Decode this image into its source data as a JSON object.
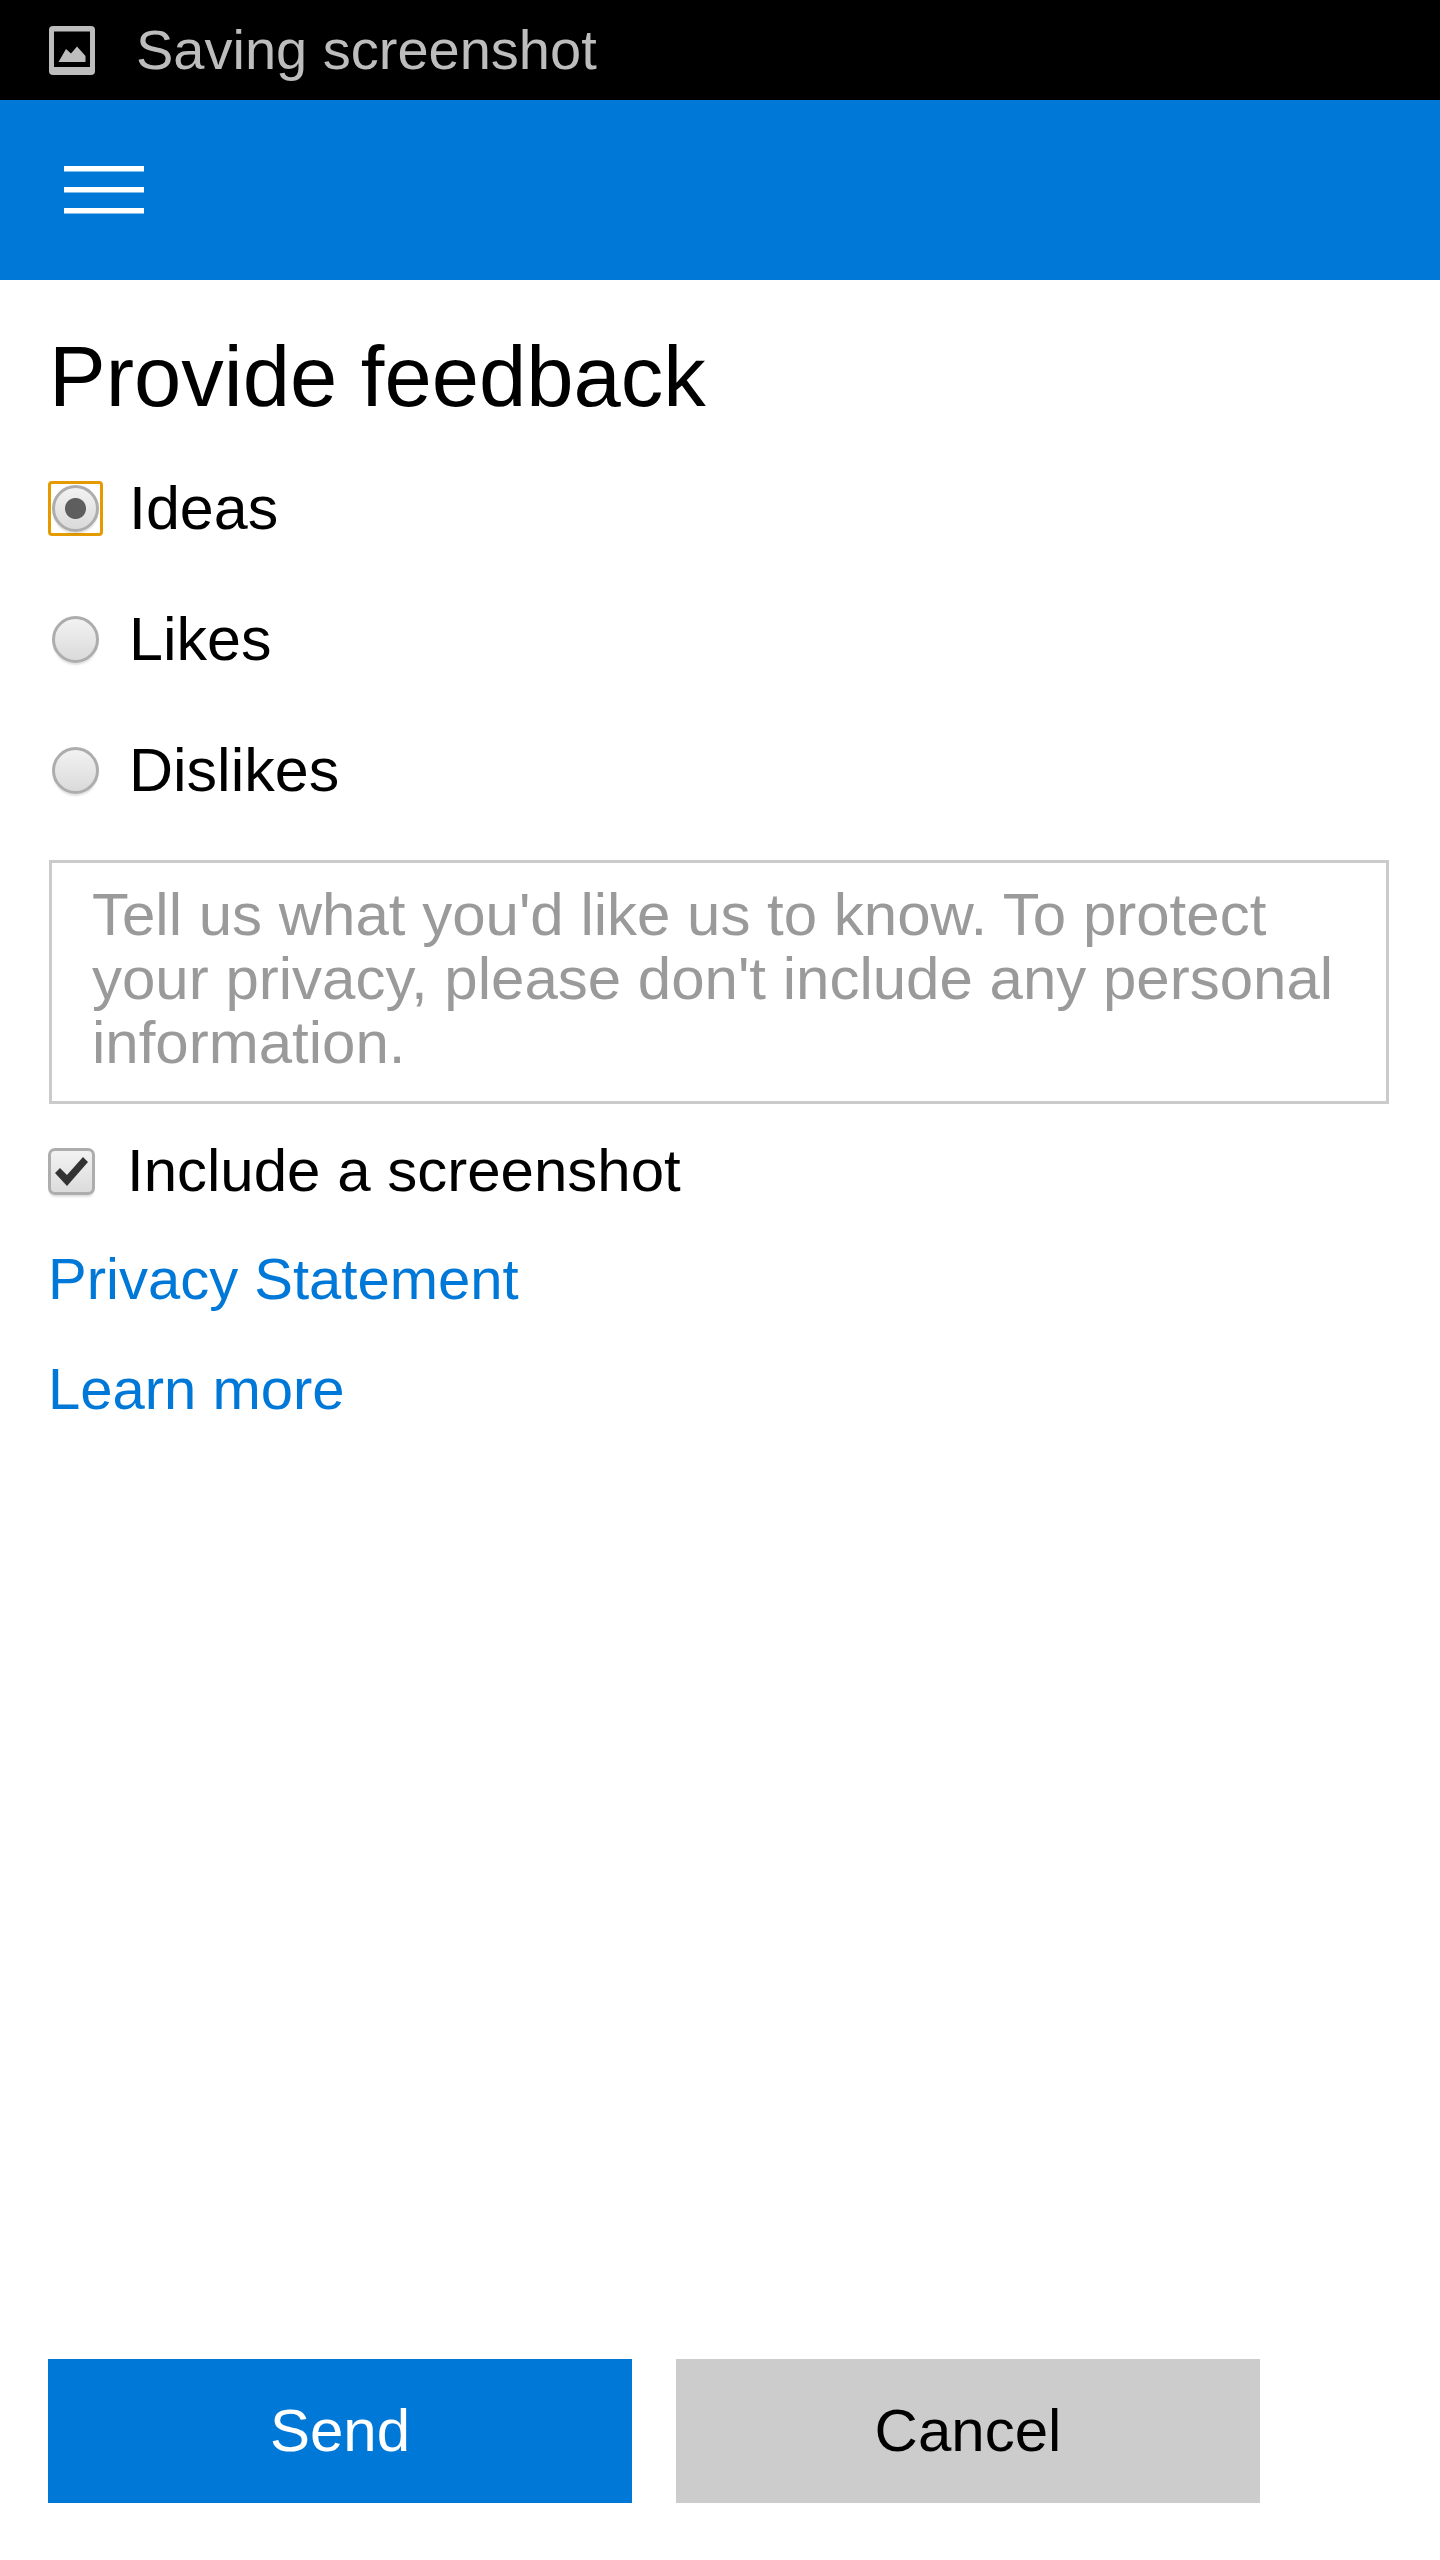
{
  "status_bar": {
    "notification": "Saving screenshot"
  },
  "title": "Provide feedback",
  "feedback_types": [
    {
      "label": "Ideas",
      "selected": true,
      "focused": true
    },
    {
      "label": "Likes",
      "selected": false,
      "focused": false
    },
    {
      "label": "Dislikes",
      "selected": false,
      "focused": false
    }
  ],
  "comment": {
    "placeholder": "Tell us what you'd like us to know. To protect your privacy, please don't include any personal information."
  },
  "screenshot_option": {
    "label": "Include a screenshot",
    "checked": true
  },
  "links": [
    "Privacy Statement",
    "Learn more"
  ],
  "buttons": [
    {
      "label": "Send",
      "kind": "primary"
    },
    {
      "label": "Cancel",
      "kind": "secondary"
    }
  ]
}
